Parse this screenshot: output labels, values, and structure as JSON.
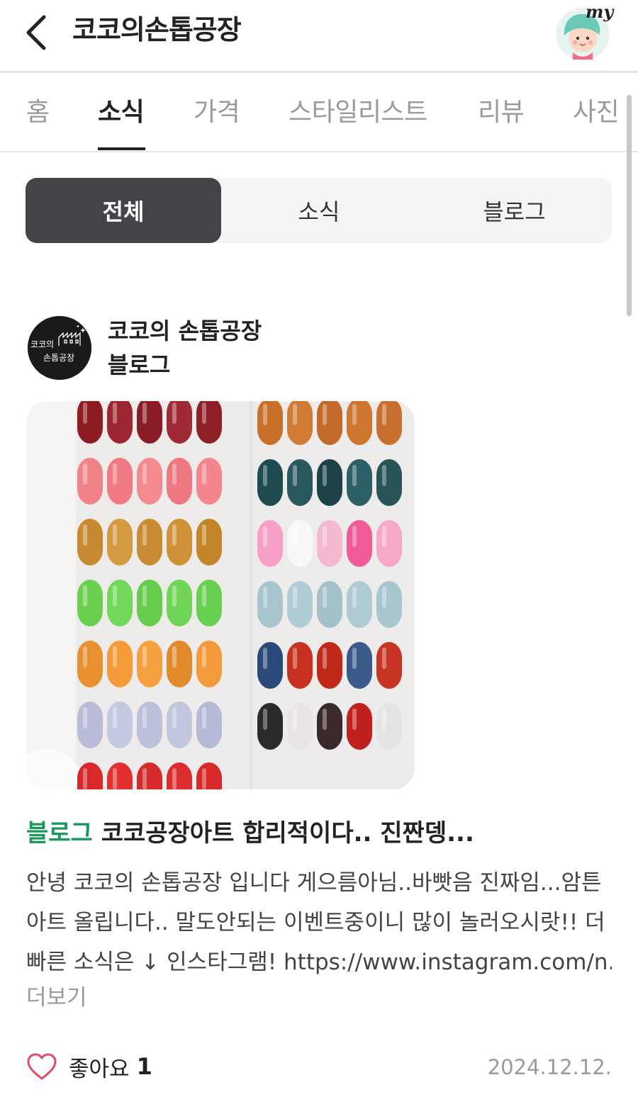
{
  "header": {
    "title": "코코의손톱공장",
    "avatar_badge": "my"
  },
  "tabs": [
    {
      "label": "홈"
    },
    {
      "label": "소식"
    },
    {
      "label": "가격"
    },
    {
      "label": "스타일리스트"
    },
    {
      "label": "리뷰"
    },
    {
      "label": "사진"
    }
  ],
  "active_tab": "소식",
  "filter": {
    "options": [
      "전체",
      "소식",
      "블로그"
    ],
    "selected": "전체"
  },
  "post": {
    "author_logo_text": [
      "코코의",
      "손톱공장"
    ],
    "author_name": "코코의 손톱공장",
    "author_type": "블로그",
    "title_tag": "블로그",
    "title": "코코공장아트 합리적이다.. 진짠뎅...",
    "body_lines": [
      "안녕 코코의 손톱공장 입니다 게으름아님..바빳음 진짜임...암튼",
      "아트 올립니다.. 말도안되는 이벤트중이니 많이 놀러오시랏!! 더",
      "빠른 소식은 ↓ 인스타그램! https://www.instagram.com/n..."
    ],
    "more_label": "더보기",
    "like_label": "좋아요",
    "like_count": "1",
    "date": "2024.12.12."
  },
  "colors": {
    "accent_green": "#1a9a5a",
    "segment_active": "#444448"
  }
}
